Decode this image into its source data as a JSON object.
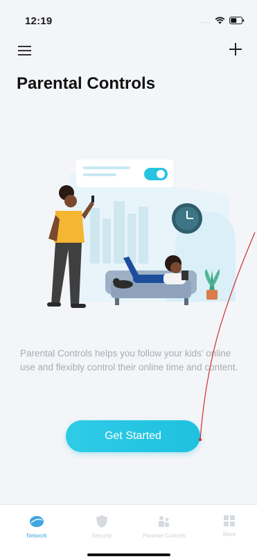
{
  "status_bar": {
    "time": "12:19",
    "icons": [
      "signal-dots-icon",
      "wifi-icon",
      "battery-icon"
    ]
  },
  "header": {
    "menu_icon": "hamburger-menu-icon",
    "add_icon": "plus-icon",
    "title": "Parental Controls"
  },
  "illustration": {
    "icon": "parental-controls-illustration"
  },
  "description": "Parental Controls helps you follow your kids' online use and flexibly control their online time and content.",
  "cta": {
    "label": "Get Started"
  },
  "tab_bar": {
    "items": [
      {
        "label": "Network",
        "icon": "network-icon",
        "active": true
      },
      {
        "label": "Security",
        "icon": "shield-icon",
        "active": false
      },
      {
        "label": "Parental Controls",
        "icon": "family-icon",
        "active": false
      },
      {
        "label": "More",
        "icon": "grid-icon",
        "active": false
      }
    ]
  },
  "colors": {
    "accent": "#27c4e2",
    "active_tab": "#3ea6e0",
    "background": "#f3f5f8",
    "annotation": "#d42a2a"
  }
}
